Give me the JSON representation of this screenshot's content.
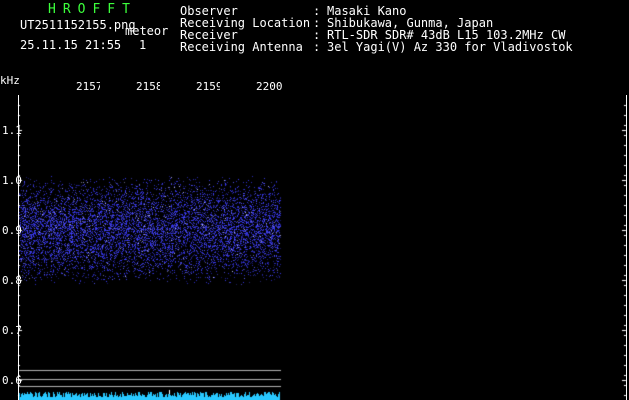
{
  "header": {
    "app_title": "HROFFT",
    "filename": "UT2511152155.png",
    "mode": "meteor",
    "datetime": "25.11.15 21:55",
    "count": "1"
  },
  "station": [
    {
      "label": "Observer",
      "value": "Masaki Kano"
    },
    {
      "label": "Receiving Location",
      "value": "Shibukawa, Gunma, Japan"
    },
    {
      "label": "Receiver",
      "value": "RTL-SDR SDR# 43dB L15 103.2MHz CW"
    },
    {
      "label": "Receiving Antenna",
      "value": "3el Yagi(V) Az 330 for Vladivostok"
    }
  ],
  "plot": {
    "y_unit": "kHz",
    "y_ticks": [
      "1.1",
      "1.0",
      "0.9",
      "0.8",
      "0.7",
      "0.6"
    ],
    "time_labels": [
      "2157",
      "2158",
      "2159",
      "2200"
    ],
    "signal_band_khz": [
      0.8,
      1.0
    ],
    "colors": {
      "noise": "#3c3cff",
      "trace": "#28c8ff",
      "lines": "#ffffff",
      "title": "#3cff3c"
    }
  }
}
